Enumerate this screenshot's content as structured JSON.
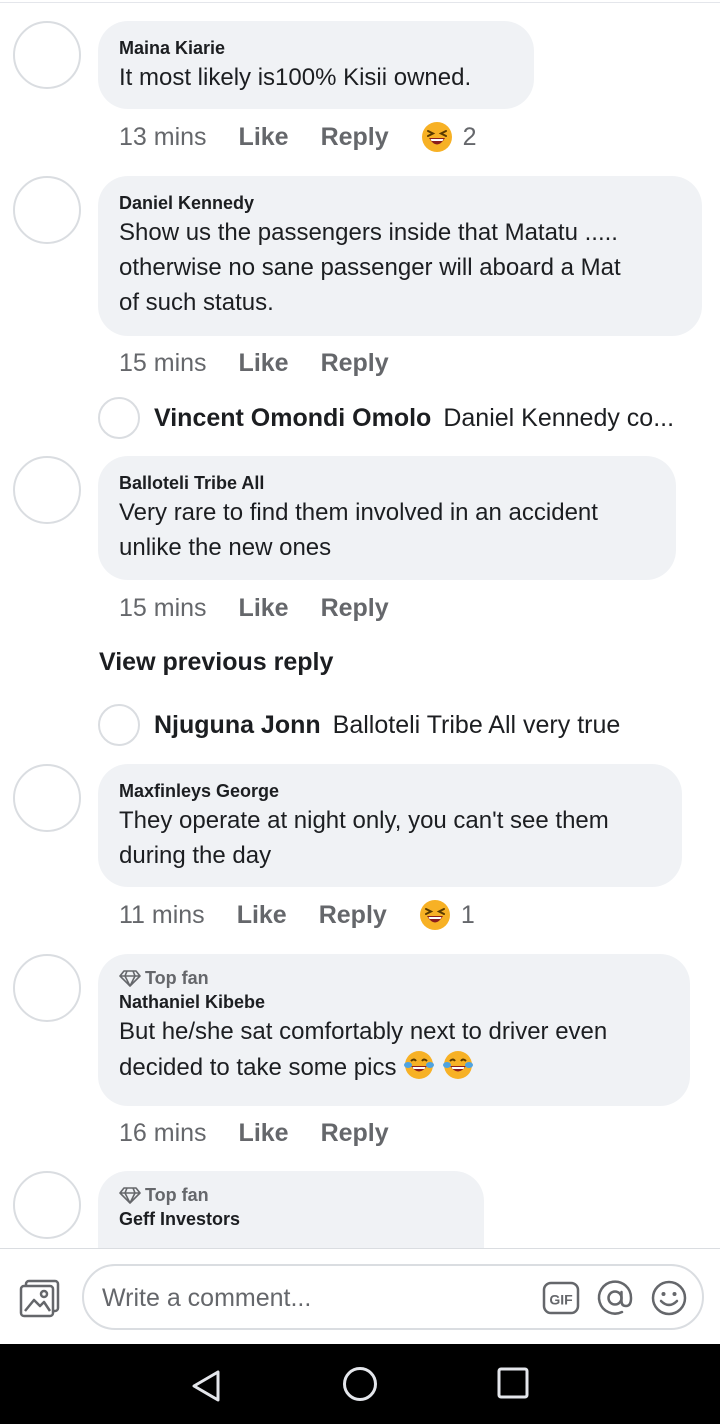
{
  "comments": [
    {
      "author": "Maina Kiarie",
      "text": "It most likely is100% Kisii owned.",
      "time": "13 mins",
      "like_label": "Like",
      "reply_label": "Reply",
      "reaction": "laughing-emoji",
      "reaction_count": "2"
    },
    {
      "author": "Daniel Kennedy",
      "text_lines": [
        "Show us the passengers inside that Matatu .....",
        "otherwise no sane passenger will aboard a Mat",
        "of such status."
      ],
      "time": "15 mins",
      "like_label": "Like",
      "reply_label": "Reply",
      "reply_preview": {
        "name": "Vincent Omondi Omolo",
        "text": "Daniel Kennedy co..."
      }
    },
    {
      "author": "Balloteli Tribe All",
      "text_lines": [
        "Very rare to find them involved in an accident",
        "unlike the new ones"
      ],
      "time": "15 mins",
      "like_label": "Like",
      "reply_label": "Reply",
      "view_previous": "View previous reply",
      "reply_preview": {
        "name": "Njuguna Jonn",
        "text": "Balloteli Tribe All very true"
      }
    },
    {
      "author": "Maxfinleys George",
      "text_lines": [
        "They operate at night only, you can't see them",
        "during the day"
      ],
      "time": "11 mins",
      "like_label": "Like",
      "reply_label": "Reply",
      "reaction": "laughing-emoji",
      "reaction_count": "1"
    },
    {
      "badge": "Top fan",
      "author": "Nathaniel Kibebe",
      "text_lines": [
        "But he/she sat comfortably next to driver even",
        "decided to take some pics"
      ],
      "inline_emojis": [
        "tears-of-joy-emoji",
        "tears-of-joy-emoji"
      ],
      "time": "16 mins",
      "like_label": "Like",
      "reply_label": "Reply"
    },
    {
      "badge": "Top fan",
      "author": "Geff Investors"
    }
  ],
  "composer": {
    "placeholder": "Write a comment...",
    "gif_label": "GIF"
  },
  "colors": {
    "bubble": "#f0f2f5",
    "secondary_text": "#65676b",
    "primary_text": "#1c1e21",
    "emoji_yellow": "#f7b125"
  }
}
